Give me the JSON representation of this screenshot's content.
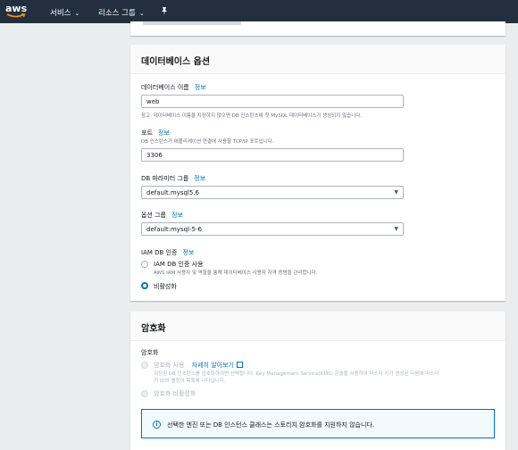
{
  "topnav": {
    "logo": "aws",
    "services": "서비스",
    "resource_groups": "리소스 그룹",
    "caret": "⌄",
    "pin_icon": "pin-icon"
  },
  "db_options": {
    "title": "데이터베이스 옵션",
    "info": "정보",
    "db_name": {
      "label": "데이터베이스 이름",
      "value": "web",
      "desc": "참고: 데이터베이스 이름을 지정하지 않으면 DB 인스턴스에 첫 MySQL 데이터베이스가 생성되지 않습니다."
    },
    "port": {
      "label": "포트",
      "desc": "DB 인스턴스가 애플리케이션 연결에 사용할 TCP/IP 포트입니다.",
      "value": "3306"
    },
    "param_group": {
      "label": "DB 파라미터 그룹",
      "value": "default.mysql5.6"
    },
    "option_group": {
      "label": "옵션 그룹",
      "value": "default:mysql-5-6"
    },
    "iam": {
      "label": "IAM DB 인증",
      "enable_label": "IAM DB 인증 사용",
      "enable_desc": "AWS IAM 사용자 및 역할을 통해 데이터베이스 사용자 자격 증명을 관리합니다.",
      "disable_label": "비활성화",
      "selected": "disable"
    }
  },
  "encryption": {
    "title": "암호화",
    "label": "암호화",
    "enable_label": "암호화 사용",
    "learn_more": "자세히 알아보기",
    "enable_desc_1": "지정된 DB 인스턴스를 암호화하려면 선택합니다. Key Management Service(KMS) 콘솔을 사용하여 마스터 키가 생성된 다음에 마스터",
    "enable_desc_2": "키 ID와 별칭이 목록에 나타납니다.",
    "disable_label": "암호화 비활성화",
    "alert_icon": "i",
    "alert": "선택한 엔진 또는 DB 인스턴스 클래스는 스토리지 암호화를 지원하지 않습니다."
  }
}
